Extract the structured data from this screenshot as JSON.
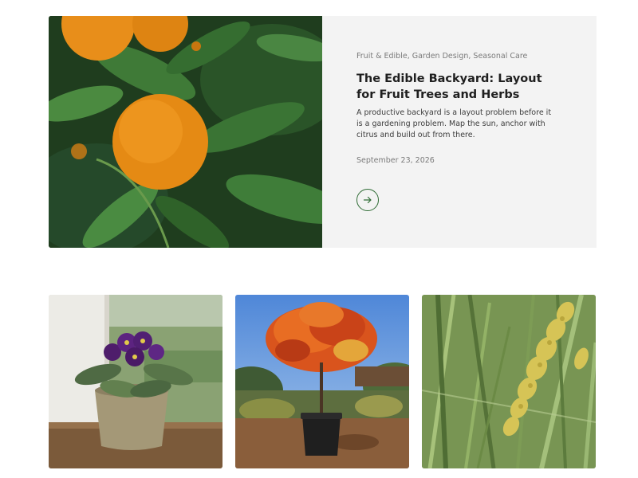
{
  "featured": {
    "categories": "Fruit & Edible, Garden Design, Seasonal Care",
    "title": "The Edible Backyard: Layout for Fruit Trees and Herbs",
    "excerpt": "A productive backyard is a layout problem before it is a gardening problem. Map the sun, anchor with citrus and build out from there.",
    "date": "September 23, 2026",
    "image_icon": "orange-tree-photo",
    "arrow_icon": "arrow-right-icon"
  },
  "cards": [
    {
      "image_icon": "african-violet-photo"
    },
    {
      "image_icon": "potted-maple-tree-photo"
    },
    {
      "image_icon": "ornamental-grass-photo"
    }
  ],
  "colors": {
    "accent": "#2e6b34",
    "featured_bg": "#f3f3f3",
    "title": "#1f1f1f",
    "meta": "#7a7a7a"
  }
}
